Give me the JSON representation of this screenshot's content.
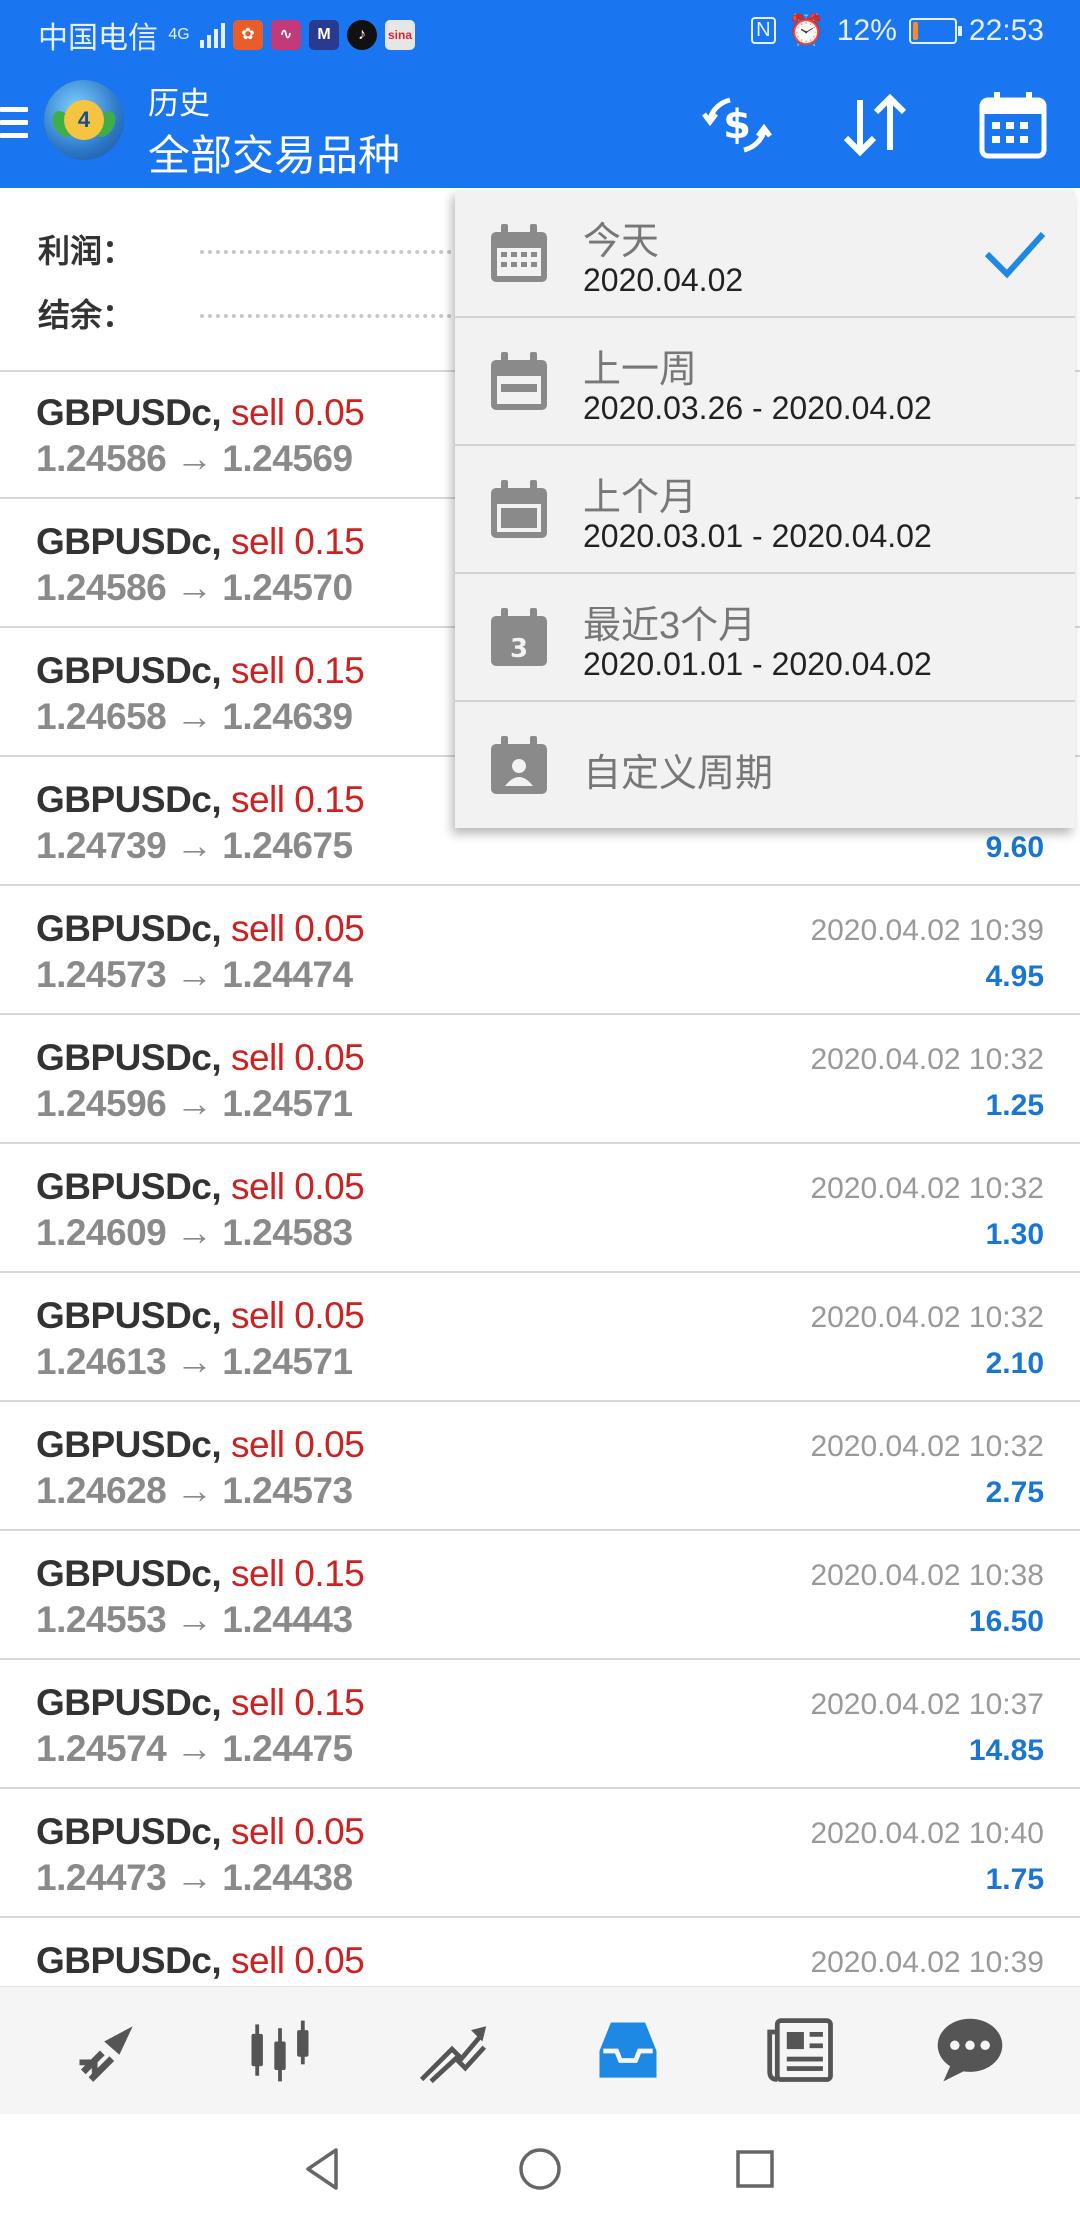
{
  "status_bar": {
    "carrier": "中国电信",
    "network": "4G",
    "nfc": "N",
    "battery_percent": "12%",
    "battery_level": 0.12,
    "time": "22:53"
  },
  "app_bar": {
    "subtitle": "历史",
    "title": "全部交易品种",
    "logo_number": "4",
    "icons": [
      "currency-exchange-icon",
      "sort-icon",
      "calendar-icon"
    ]
  },
  "summary": {
    "profit_label": "利润：",
    "balance_label": "结余："
  },
  "period_menu": [
    {
      "label": "今天",
      "range": "2020.04.02",
      "icon": "calendar-today-icon",
      "selected": true
    },
    {
      "label": "上一周",
      "range": "2020.03.26 - 2020.04.02",
      "icon": "calendar-week-icon",
      "selected": false
    },
    {
      "label": "上个月",
      "range": "2020.03.01 - 2020.04.02",
      "icon": "calendar-month-icon",
      "selected": false
    },
    {
      "label": "最近3个月",
      "range": "2020.01.01 - 2020.04.02",
      "icon": "calendar-3months-icon",
      "icon_text": "3",
      "selected": false
    },
    {
      "label": "自定义周期",
      "icon": "calendar-custom-icon",
      "selected": false
    }
  ],
  "trades": [
    {
      "symbol": "GBPUSDc,",
      "side": "sell 0.05",
      "prices": "1.24586 → 1.24569",
      "time": "",
      "profit": ""
    },
    {
      "symbol": "GBPUSDc,",
      "side": "sell 0.15",
      "prices": "1.24586 → 1.24570",
      "time": "",
      "profit": ""
    },
    {
      "symbol": "GBPUSDc,",
      "side": "sell 0.15",
      "prices": "1.24658 → 1.24639",
      "time": "",
      "profit": ""
    },
    {
      "symbol": "GBPUSDc,",
      "side": "sell 0.15",
      "prices": "1.24739 → 1.24675",
      "time": "",
      "profit": "9.60"
    },
    {
      "symbol": "GBPUSDc,",
      "side": "sell 0.05",
      "prices": "1.24573 → 1.24474",
      "time": "2020.04.02 10:39",
      "profit": "4.95"
    },
    {
      "symbol": "GBPUSDc,",
      "side": "sell 0.05",
      "prices": "1.24596 → 1.24571",
      "time": "2020.04.02 10:32",
      "profit": "1.25"
    },
    {
      "symbol": "GBPUSDc,",
      "side": "sell 0.05",
      "prices": "1.24609 → 1.24583",
      "time": "2020.04.02 10:32",
      "profit": "1.30"
    },
    {
      "symbol": "GBPUSDc,",
      "side": "sell 0.05",
      "prices": "1.24613 → 1.24571",
      "time": "2020.04.02 10:32",
      "profit": "2.10"
    },
    {
      "symbol": "GBPUSDc,",
      "side": "sell 0.05",
      "prices": "1.24628 → 1.24573",
      "time": "2020.04.02 10:32",
      "profit": "2.75"
    },
    {
      "symbol": "GBPUSDc,",
      "side": "sell 0.15",
      "prices": "1.24553 → 1.24443",
      "time": "2020.04.02 10:38",
      "profit": "16.50"
    },
    {
      "symbol": "GBPUSDc,",
      "side": "sell 0.15",
      "prices": "1.24574 → 1.24475",
      "time": "2020.04.02 10:37",
      "profit": "14.85"
    },
    {
      "symbol": "GBPUSDc,",
      "side": "sell 0.05",
      "prices": "1.24473 → 1.24438",
      "time": "2020.04.02 10:40",
      "profit": "1.75"
    },
    {
      "symbol": "GBPUSDc,",
      "side": "sell 0.05",
      "prices": "",
      "time": "2020.04.02 10:39",
      "profit": ""
    }
  ],
  "bottom_nav": [
    {
      "name": "quotes-icon",
      "active": false
    },
    {
      "name": "chart-icon",
      "active": false
    },
    {
      "name": "trade-icon",
      "active": false
    },
    {
      "name": "history-icon",
      "active": true
    },
    {
      "name": "news-icon",
      "active": false
    },
    {
      "name": "chat-icon",
      "active": false
    }
  ],
  "system_nav": [
    "back-icon",
    "home-icon",
    "recents-icon"
  ],
  "colors": {
    "primary": "#1976f0",
    "sell": "#cc2222",
    "profit": "#1976d2",
    "active_tab": "#1e88e5",
    "inactive_icon": "#555555"
  }
}
